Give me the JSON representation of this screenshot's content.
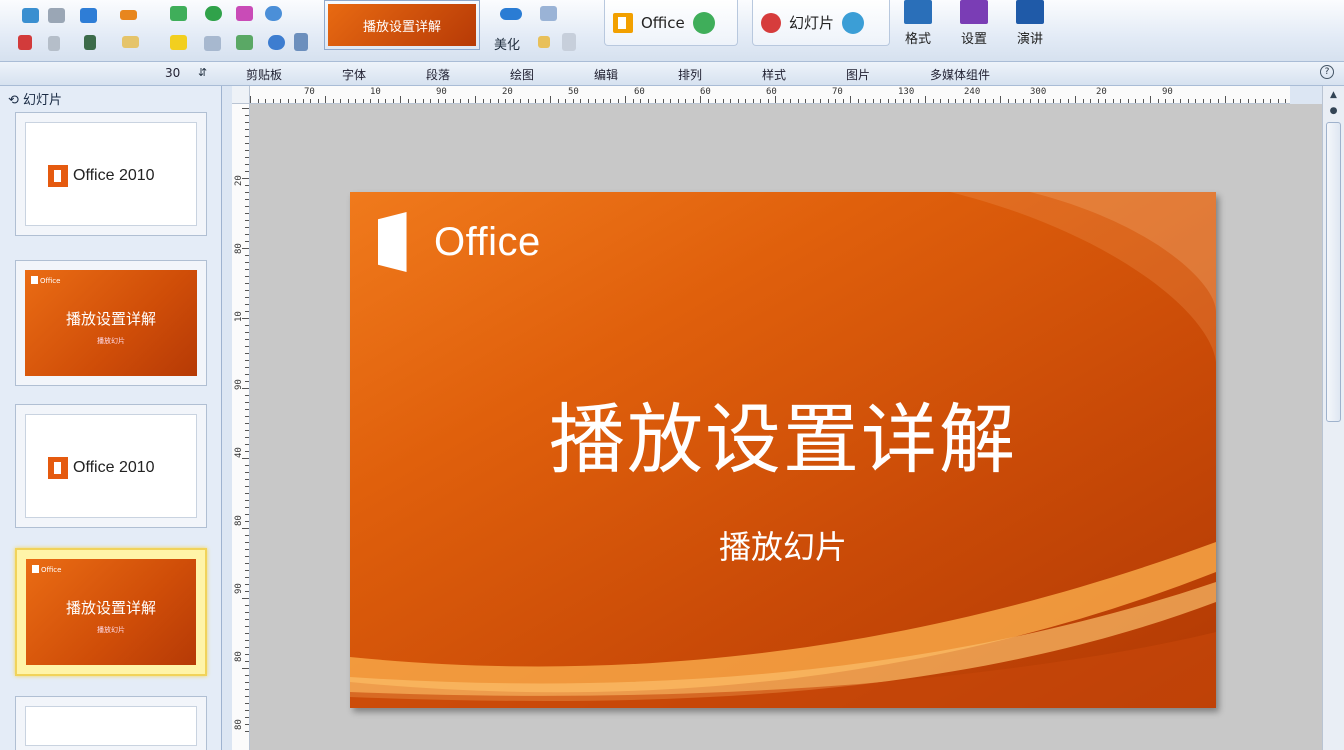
{
  "ribbon": {
    "current_slide_thumb": "播放设置详解",
    "office_button": "Office",
    "slideshow_button": "幻灯片",
    "big_buttons": [
      {
        "label": "格式",
        "icon": "monitor-icon",
        "color": "#2a6fb9"
      },
      {
        "label": "设置",
        "icon": "presentation-icon",
        "color": "#7a3db5"
      },
      {
        "label": "演讲",
        "icon": "laptop-icon",
        "color": "#1f5aa8"
      }
    ],
    "small_labels": {
      "a": "剪贴板"
    }
  },
  "subbar": {
    "zoom_value": "30",
    "tabs": [
      "剪贴板",
      "字体",
      "段落",
      "绘图",
      "编辑",
      "排列",
      "样式",
      "图片",
      "多媒体组件"
    ]
  },
  "panel": {
    "title": "幻灯片",
    "slides": [
      {
        "type": "logo",
        "text": "Office 2010"
      },
      {
        "type": "orange",
        "office": "Office",
        "title": "播放设置详解",
        "sub": "播放幻片"
      },
      {
        "type": "logo",
        "text": "Office 2010"
      },
      {
        "type": "orange",
        "office": "Office",
        "title": "播放设置详解",
        "sub": "播放幻片"
      }
    ]
  },
  "ruler": {
    "h_labels": [
      "70",
      "10",
      "90",
      "20",
      "50",
      "60",
      "60",
      "60",
      "70",
      "130",
      "240",
      "300",
      "20",
      "90"
    ],
    "v_labels": [
      "20",
      "80",
      "10",
      "90",
      "40",
      "80",
      "90",
      "80",
      "80"
    ]
  },
  "slide": {
    "logo_text": "Office",
    "title": "播放设置详解",
    "subtitle": "播放幻片",
    "colors": {
      "accent": "#e0600c",
      "dark": "#b13904",
      "light": "#f07a1c"
    }
  }
}
